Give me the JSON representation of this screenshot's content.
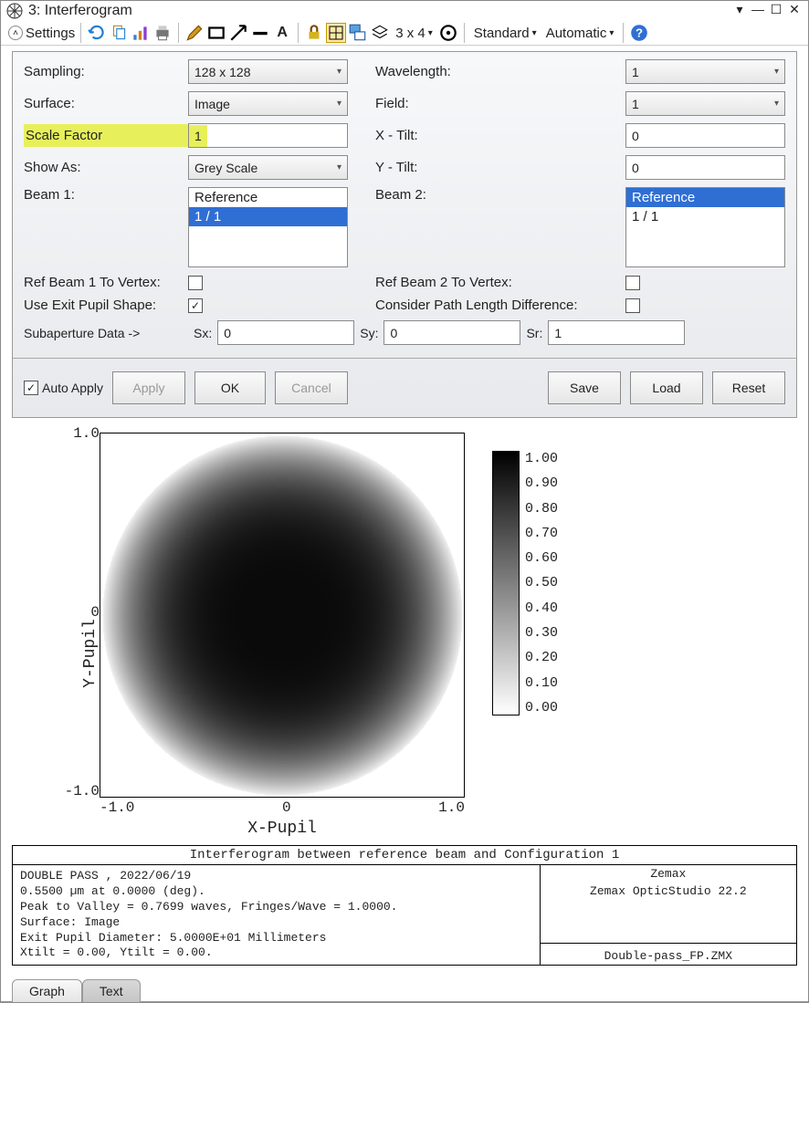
{
  "window": {
    "title": "3: Interferogram"
  },
  "toolbar": {
    "settings_label": "Settings",
    "zoom_label": "3 x 4",
    "mode1": "Standard",
    "mode2": "Automatic"
  },
  "settings": {
    "sampling": {
      "label": "Sampling:",
      "value": "128 x 128"
    },
    "surface": {
      "label": "Surface:",
      "value": "Image"
    },
    "scale": {
      "label": "Scale Factor",
      "value": "1"
    },
    "showas": {
      "label": "Show As:",
      "value": "Grey Scale"
    },
    "beam1": {
      "label": "Beam 1:",
      "items": [
        "Reference",
        "1 / 1"
      ],
      "selected": 1
    },
    "wavelength": {
      "label": "Wavelength:",
      "value": "1"
    },
    "field": {
      "label": "Field:",
      "value": "1"
    },
    "xtilt": {
      "label": "X - Tilt:",
      "value": "0"
    },
    "ytilt": {
      "label": "Y - Tilt:",
      "value": "0"
    },
    "beam2": {
      "label": "Beam 2:",
      "items": [
        "Reference",
        "1 / 1"
      ],
      "selected": 0
    },
    "refbeam1": "Ref Beam 1 To Vertex:",
    "useexit": "Use Exit Pupil Shape:",
    "refbeam2": "Ref Beam 2 To Vertex:",
    "consider": "Consider Path Length Difference:",
    "subap_label": "Subaperture Data ->",
    "sx_label": "Sx:",
    "sx": "0",
    "sy_label": "Sy:",
    "sy": "0",
    "sr_label": "Sr:",
    "sr": "1",
    "autoapply": "Auto Apply",
    "btn_apply": "Apply",
    "btn_ok": "OK",
    "btn_cancel": "Cancel",
    "btn_save": "Save",
    "btn_load": "Load",
    "btn_reset": "Reset"
  },
  "chart_data": {
    "type": "heatmap",
    "title": "",
    "xlabel": "X-Pupil",
    "ylabel": "Y-Pupil",
    "x_ticks": [
      "-1.0",
      "0",
      "1.0"
    ],
    "y_ticks": [
      "1.0",
      "0",
      "-1.0"
    ],
    "colorbar_ticks": [
      "1.00",
      "0.90",
      "0.80",
      "0.70",
      "0.60",
      "0.50",
      "0.40",
      "0.30",
      "0.20",
      "0.10",
      "0.00"
    ],
    "value_range": [
      0.0,
      1.0
    ],
    "note": "Greyscale interferogram over unit pupil; bright ring near edges fading to near-black center."
  },
  "info": {
    "title": "Interferogram between reference beam and Configuration 1",
    "left_lines": [
      "DOUBLE PASS , 2022/06/19",
      "0.5500 µm at 0.0000 (deg).",
      "Peak to Valley = 0.7699 waves, Fringes/Wave = 1.0000.",
      "Surface: Image",
      "Exit Pupil Diameter: 5.0000E+01 Millimeters",
      "Xtilt = 0.00, Ytilt = 0.00."
    ],
    "right_lines": [
      "Zemax",
      "Zemax OpticStudio 22.2"
    ],
    "right_file": "Double-pass_FP.ZMX"
  },
  "tabs": {
    "graph": "Graph",
    "text": "Text"
  }
}
